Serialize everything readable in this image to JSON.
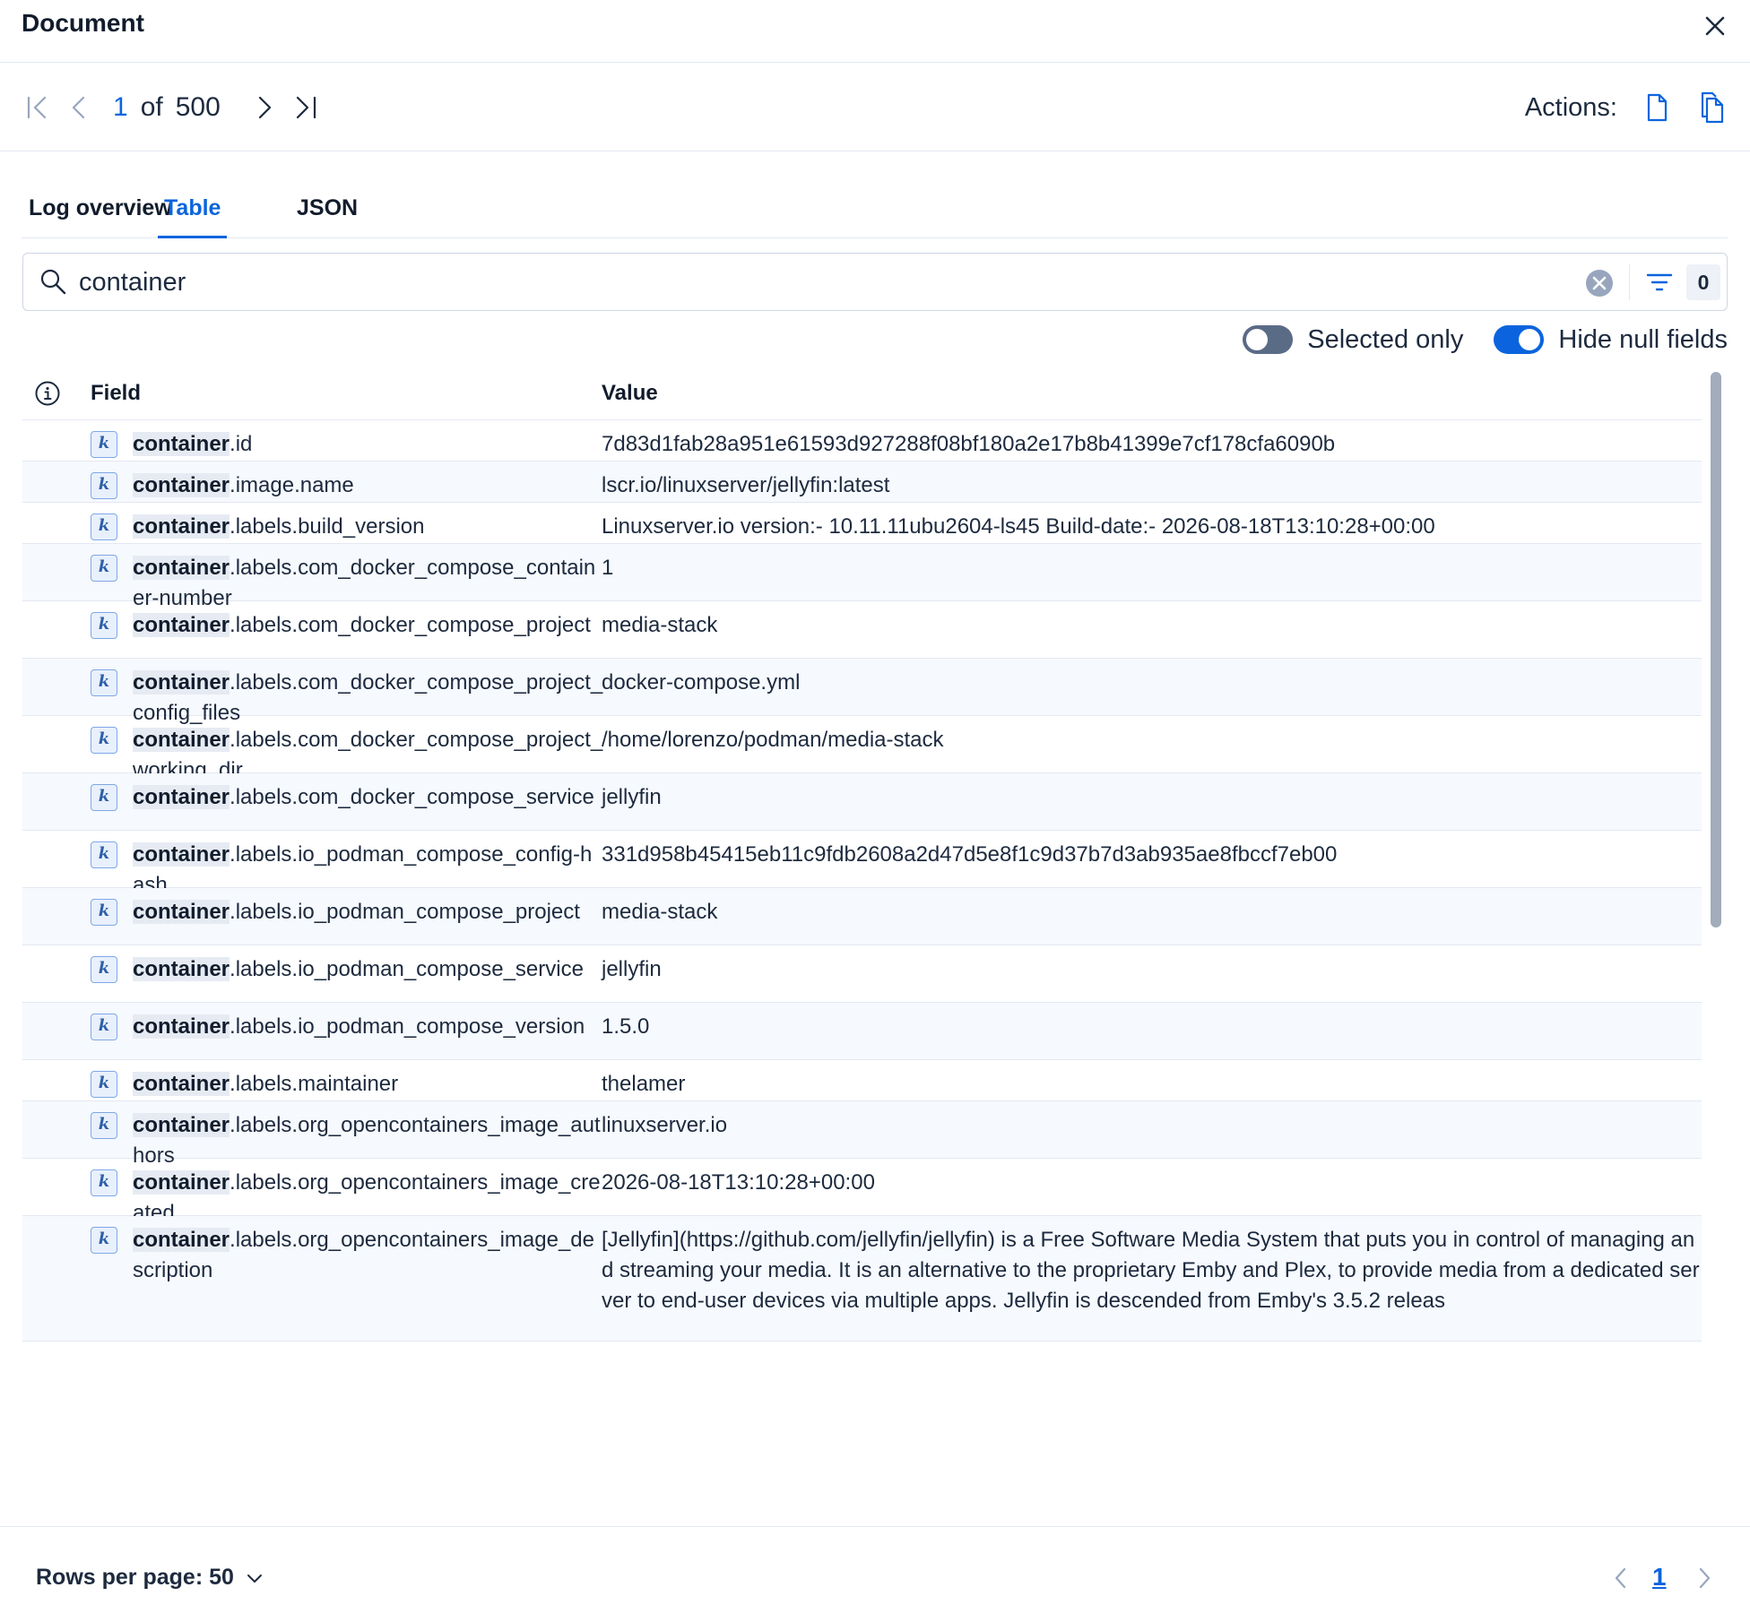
{
  "header": {
    "title": "Document"
  },
  "pager": {
    "current": "1",
    "of_label": "of",
    "total": "500"
  },
  "actions": {
    "label": "Actions:"
  },
  "tabs": [
    {
      "label": "Log overview",
      "active": false
    },
    {
      "label": "Table",
      "active": true
    },
    {
      "label": "JSON",
      "active": false
    }
  ],
  "search": {
    "value": "container",
    "filter_count": "0"
  },
  "toggles": {
    "selected_only": {
      "label": "Selected only",
      "on": false
    },
    "hide_null": {
      "label": "Hide null fields",
      "on": true
    }
  },
  "table": {
    "col_field": "Field",
    "col_value": "Value",
    "rows": [
      {
        "prefix": "container",
        "rest": ".id",
        "value": "7d83d1fab28a951e61593d927288f08bf180a2e17b8b41399e7cf178cfa6090b"
      },
      {
        "prefix": "container",
        "rest": ".image.name",
        "value": "lscr.io/linuxserver/jellyfin:latest"
      },
      {
        "prefix": "container",
        "rest": ".labels.build_version",
        "value": "Linuxserver.io version:- 10.11.11ubu2604-ls45 Build-date:- 2026-08-18T13:10:28+00:00"
      },
      {
        "prefix": "container",
        "rest": ".labels.com_docker_compose_container-number",
        "value": "1"
      },
      {
        "prefix": "container",
        "rest": ".labels.com_docker_compose_project",
        "value": "media-stack"
      },
      {
        "prefix": "container",
        "rest": ".labels.com_docker_compose_project_config_files",
        "value": "docker-compose.yml"
      },
      {
        "prefix": "container",
        "rest": ".labels.com_docker_compose_project_working_dir",
        "value": "/home/lorenzo/podman/media-stack"
      },
      {
        "prefix": "container",
        "rest": ".labels.com_docker_compose_service",
        "value": "jellyfin"
      },
      {
        "prefix": "container",
        "rest": ".labels.io_podman_compose_config-hash",
        "value": "331d958b45415eb11c9fdb2608a2d47d5e8f1c9d37b7d3ab935ae8fbccf7eb00"
      },
      {
        "prefix": "container",
        "rest": ".labels.io_podman_compose_project",
        "value": "media-stack"
      },
      {
        "prefix": "container",
        "rest": ".labels.io_podman_compose_service",
        "value": "jellyfin"
      },
      {
        "prefix": "container",
        "rest": ".labels.io_podman_compose_version",
        "value": "1.5.0"
      },
      {
        "prefix": "container",
        "rest": ".labels.maintainer",
        "value": "thelamer"
      },
      {
        "prefix": "container",
        "rest": ".labels.org_opencontainers_image_authors",
        "value": "linuxserver.io"
      },
      {
        "prefix": "container",
        "rest": ".labels.org_opencontainers_image_created",
        "value": "2026-08-18T13:10:28+00:00"
      },
      {
        "prefix": "container",
        "rest": ".labels.org_opencontainers_image_description",
        "value": "[Jellyfin](https://github.com/jellyfin/jellyfin) is a Free Software Media System that puts you in control of managing and streaming your media. It is an alternative to the proprietary Emby and Plex, to provide media from a dedicated server to end-user devices via multiple apps. Jellyfin is descended from Emby's 3.5.2 releas"
      }
    ]
  },
  "footer": {
    "rows_per_page": "Rows per page: 50",
    "page": "1"
  }
}
